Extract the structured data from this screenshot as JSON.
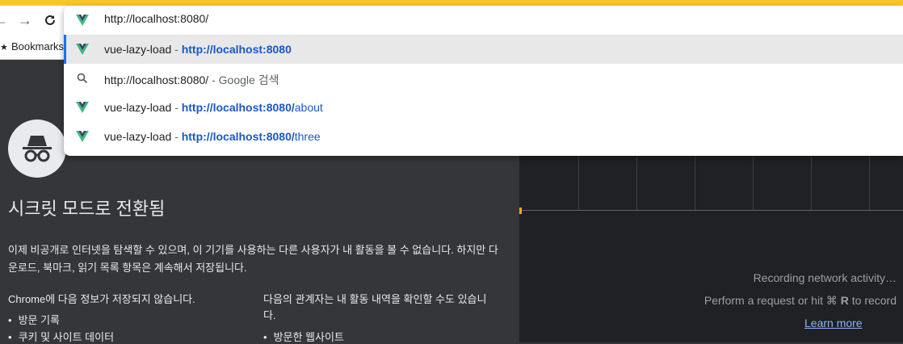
{
  "accent": "#f9c52e",
  "toolbar": {
    "back_icon": "back-arrow-icon",
    "forward_icon": "forward-arrow-icon",
    "reload_icon": "reload-icon"
  },
  "bookmarks_bar": {
    "label": "Bookmarks"
  },
  "omnibox": {
    "input_value": "http://localhost:8080/",
    "suggestions": [
      {
        "icon": "vue-logo-icon",
        "title": "vue-lazy-load",
        "separator": " - ",
        "url_bold": "http://localhost:8080",
        "url_rest": ""
      },
      {
        "icon": "search-icon",
        "title": "http://localhost:8080/",
        "separator": " - ",
        "suffix": "Google 검색"
      },
      {
        "icon": "vue-logo-icon",
        "title": "vue-lazy-load",
        "separator": " - ",
        "url_bold": "http://localhost:8080/",
        "url_rest": "about"
      },
      {
        "icon": "vue-logo-icon",
        "title": "vue-lazy-load",
        "separator": " - ",
        "url_bold": "http://localhost:8080/",
        "url_rest": "three"
      }
    ]
  },
  "incognito": {
    "title": "시크릿 모드로 전환됨",
    "description": "이제 비공개로 인터넷을 탐색할 수 있으며, 이 기기를 사용하는 다른 사용자가 내 활동을 볼 수 없습니다. 하지만 다운로드, 북마크, 읽기 목록 항목은 계속해서 저장됩니다.",
    "left_heading": "Chrome에 다음 정보가 저장되지 않습니다.",
    "left_items": [
      "방문 기록",
      "쿠키 및 사이트 데이터"
    ],
    "right_heading": "다음의 관계자는 내 활동 내역을 확인할 수도 있습니다.",
    "right_items": [
      "방문한 웹사이트"
    ]
  },
  "devtools": {
    "recording_text": "Recording network activity…",
    "perform_prefix": "Perform a request or hit ",
    "perform_key_symbol": "⌘",
    "perform_key_letter": "R",
    "perform_suffix": " to record",
    "learn_more": "Learn more"
  }
}
